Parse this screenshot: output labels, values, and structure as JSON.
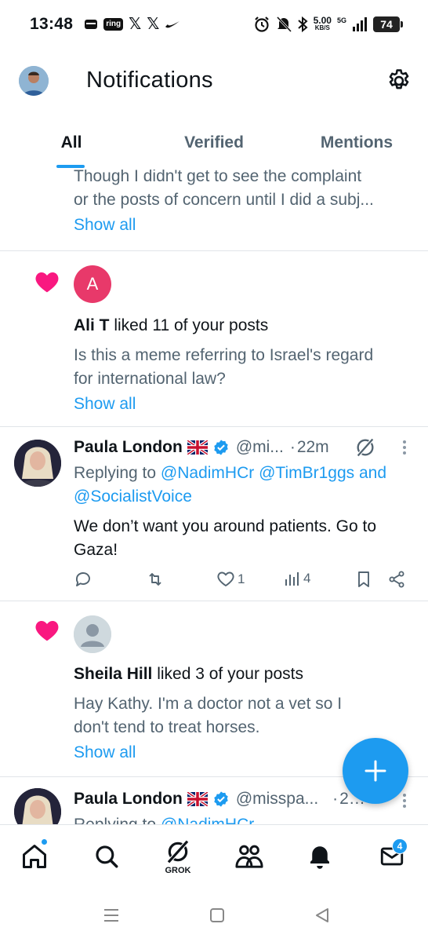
{
  "status_bar": {
    "time": "13:48",
    "ring_label": "ring",
    "x_glyph": "𝕏",
    "net_speed_value": "5.00",
    "net_speed_unit": "KB/S",
    "network_type": "5G",
    "battery": "74"
  },
  "header": {
    "title": "Notifications"
  },
  "tabs": [
    {
      "label": "All",
      "active": true
    },
    {
      "label": "Verified",
      "active": false
    },
    {
      "label": "Mentions",
      "active": false
    }
  ],
  "feed": {
    "partial_card": {
      "line1": "Though I didn't get to see the complaint",
      "line2": "or the posts of concern until I did a subj...",
      "show_all": "Show all"
    },
    "like_1": {
      "avatar_letter": "A",
      "user": "Ali T",
      "action": " liked 11 of your posts",
      "line1": "Is this a meme referring to Israel's regard",
      "line2": "for international law?",
      "show_all": "Show all"
    },
    "post_1": {
      "name": "Paula London",
      "handle": "@mi...",
      "dot": "·",
      "time": "22m",
      "replying_prefix": "Replying to ",
      "mention_1": "@NadimHCr",
      "mention_2": "@TimBr1ggs",
      "and": " and",
      "mention_3": "@SocialistVoice",
      "body_line1": "We don’t want you around patients. Go to",
      "body_line2": "Gaza!",
      "likes": "1",
      "views": "4"
    },
    "like_2": {
      "user": "Sheila Hill",
      "action": " liked 3 of your posts",
      "line1": "Hay Kathy. I'm a doctor not a vet so I",
      "line2": "don't tend to treat horses.",
      "show_all": "Show all"
    },
    "post_2": {
      "name": "Paula London",
      "handle": "@misspa...",
      "dot": "·",
      "time": "2…",
      "replying_prefix": "Replying to ",
      "mention_1": "@NadimHCr"
    }
  },
  "bottom_nav": {
    "grok_label": "GROK",
    "messages_badge": "4"
  },
  "colors": {
    "accent": "#1d9bf0",
    "like": "#f91880",
    "text_primary": "#0f1419",
    "text_secondary": "#536471"
  }
}
